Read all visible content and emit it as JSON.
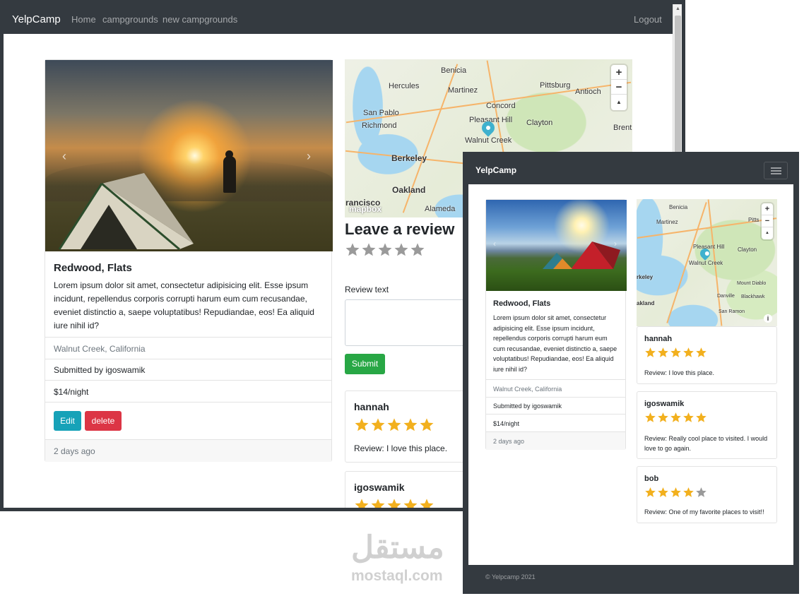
{
  "desktop": {
    "navbar": {
      "brand": "YelpCamp",
      "links": [
        "Home",
        "campgrounds",
        "new campgrounds"
      ],
      "logout": "Logout"
    },
    "campground": {
      "title": "Redwood, Flats",
      "description": "Lorem ipsum dolor sit amet, consectetur adipisicing elit. Esse ipsum incidunt, repellendus corporis corrupti harum eum cum recusandae, eveniet distinctio a, saepe voluptatibus! Repudiandae, eos! Ea aliquid iure nihil id?",
      "location": "Walnut Creek, California",
      "submitted": "Submitted by igoswamik",
      "price": "$14/night",
      "edit_label": "Edit",
      "delete_label": "delete",
      "footer": "2 days ago"
    },
    "map": {
      "cities": [
        "Benicia",
        "Hercules",
        "Martinez",
        "Pittsburg",
        "Antioch",
        "San Pablo",
        "Concord",
        "Richmond",
        "Pleasant Hill",
        "Clayton",
        "Walnut Creek",
        "Brent",
        "Berkeley",
        "Oakland",
        "Alameda",
        "rancisco"
      ],
      "attribution": "mapbox",
      "zoom_in": "+",
      "zoom_out": "−",
      "compass": "▲"
    },
    "review_form": {
      "heading": "Leave a review",
      "rating": 0,
      "label": "Review text",
      "submit_label": "Submit"
    },
    "reviews": [
      {
        "author": "hannah",
        "rating": 5,
        "text": "Review: I love this place."
      },
      {
        "author": "igoswamik",
        "rating": 5,
        "text": ""
      }
    ]
  },
  "mobile": {
    "navbar": {
      "brand": "YelpCamp"
    },
    "campground": {
      "title": "Redwood, Flats",
      "description": "Lorem ipsum dolor sit amet, consectetur adipisicing elit. Esse ipsum incidunt, repellendus corporis corrupti harum eum cum recusandae, eveniet distinctio a, saepe voluptatibus! Repudiandae, eos! Ea aliquid iure nihil id?",
      "location": "Walnut Creek, California",
      "submitted": "Submitted by igoswamik",
      "price": "$14/night",
      "footer": "2 days ago"
    },
    "map": {
      "cities": [
        "Benicia",
        "Martinez",
        "Pitts",
        "Pleasant Hill",
        "Clayton",
        "Walnut Creek",
        "rkeley",
        "Mount Diablo",
        "akland",
        "Danville",
        "Blackhawk",
        "San Ramon"
      ]
    },
    "reviews": [
      {
        "author": "hannah",
        "rating": 5,
        "text": "Review: I love this place."
      },
      {
        "author": "igoswamik",
        "rating": 5,
        "text": "Review: Really cool place to visited. I would love to go again."
      },
      {
        "author": "bob",
        "rating": 4,
        "text": "Review: One of my favorite places to visit!!"
      }
    ],
    "footer": "© Yelpcamp 2021"
  },
  "watermark": {
    "arabic": "مستقل",
    "latin": "mostaql.com"
  },
  "colors": {
    "navbar": "#343a40",
    "star_filled": "#f2b01e",
    "star_empty": "#9a9a9a",
    "edit": "#17a2b8",
    "delete": "#dc3545",
    "submit": "#28a745",
    "pin": "#3fb1ce"
  }
}
